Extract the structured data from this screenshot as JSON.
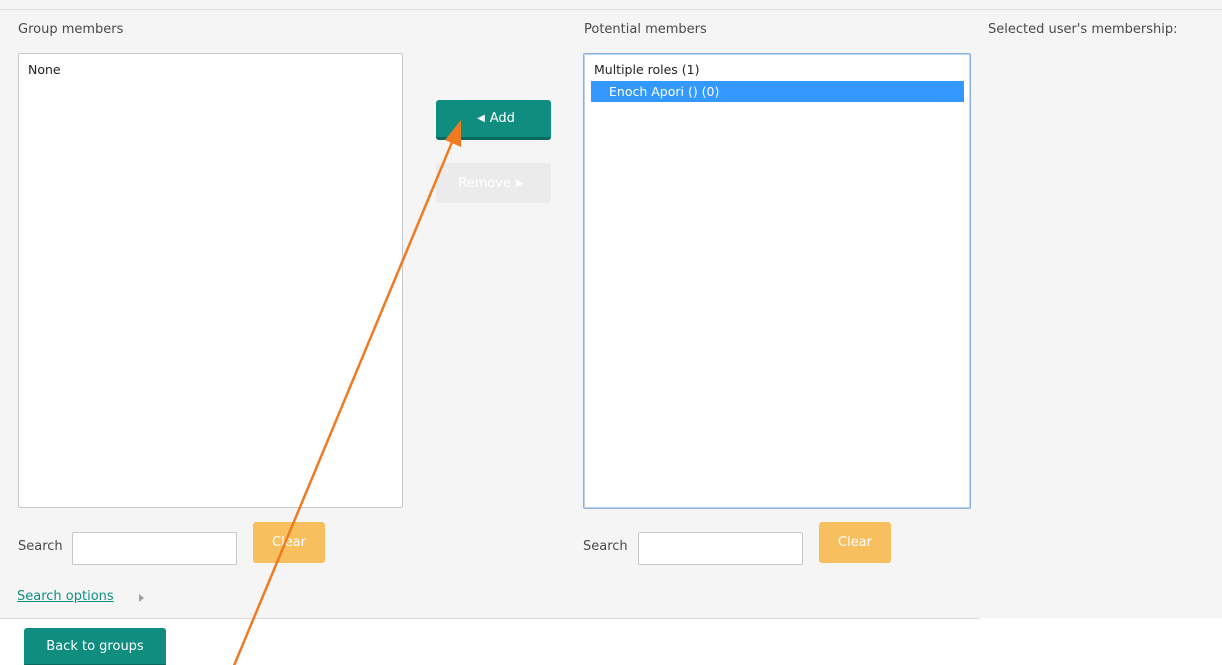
{
  "columns": {
    "group_members_label": "Group members",
    "potential_members_label": "Potential members",
    "membership_label": "Selected user's membership:"
  },
  "group_members": {
    "options": [
      "None"
    ]
  },
  "potential_members": {
    "group_label": "Multiple roles (1)",
    "selected_option": "Enoch Apori () (0)"
  },
  "actions": {
    "add_label": "Add",
    "add_icon": "left-triangle",
    "remove_label": "Remove",
    "remove_icon": "right-triangle",
    "add_color": "#0f8e80",
    "clear_color": "#f7bf5e"
  },
  "search_left": {
    "label": "Search",
    "value": "",
    "clear_label": "Clear"
  },
  "search_right": {
    "label": "Search",
    "value": "",
    "clear_label": "Clear"
  },
  "search_options": {
    "label": "Search options",
    "icon": "expand-right-triangle"
  },
  "footer": {
    "back_label": "Back to groups"
  },
  "annotation": {
    "type": "arrow",
    "color": "#f07a22",
    "points_to": "add-button"
  }
}
